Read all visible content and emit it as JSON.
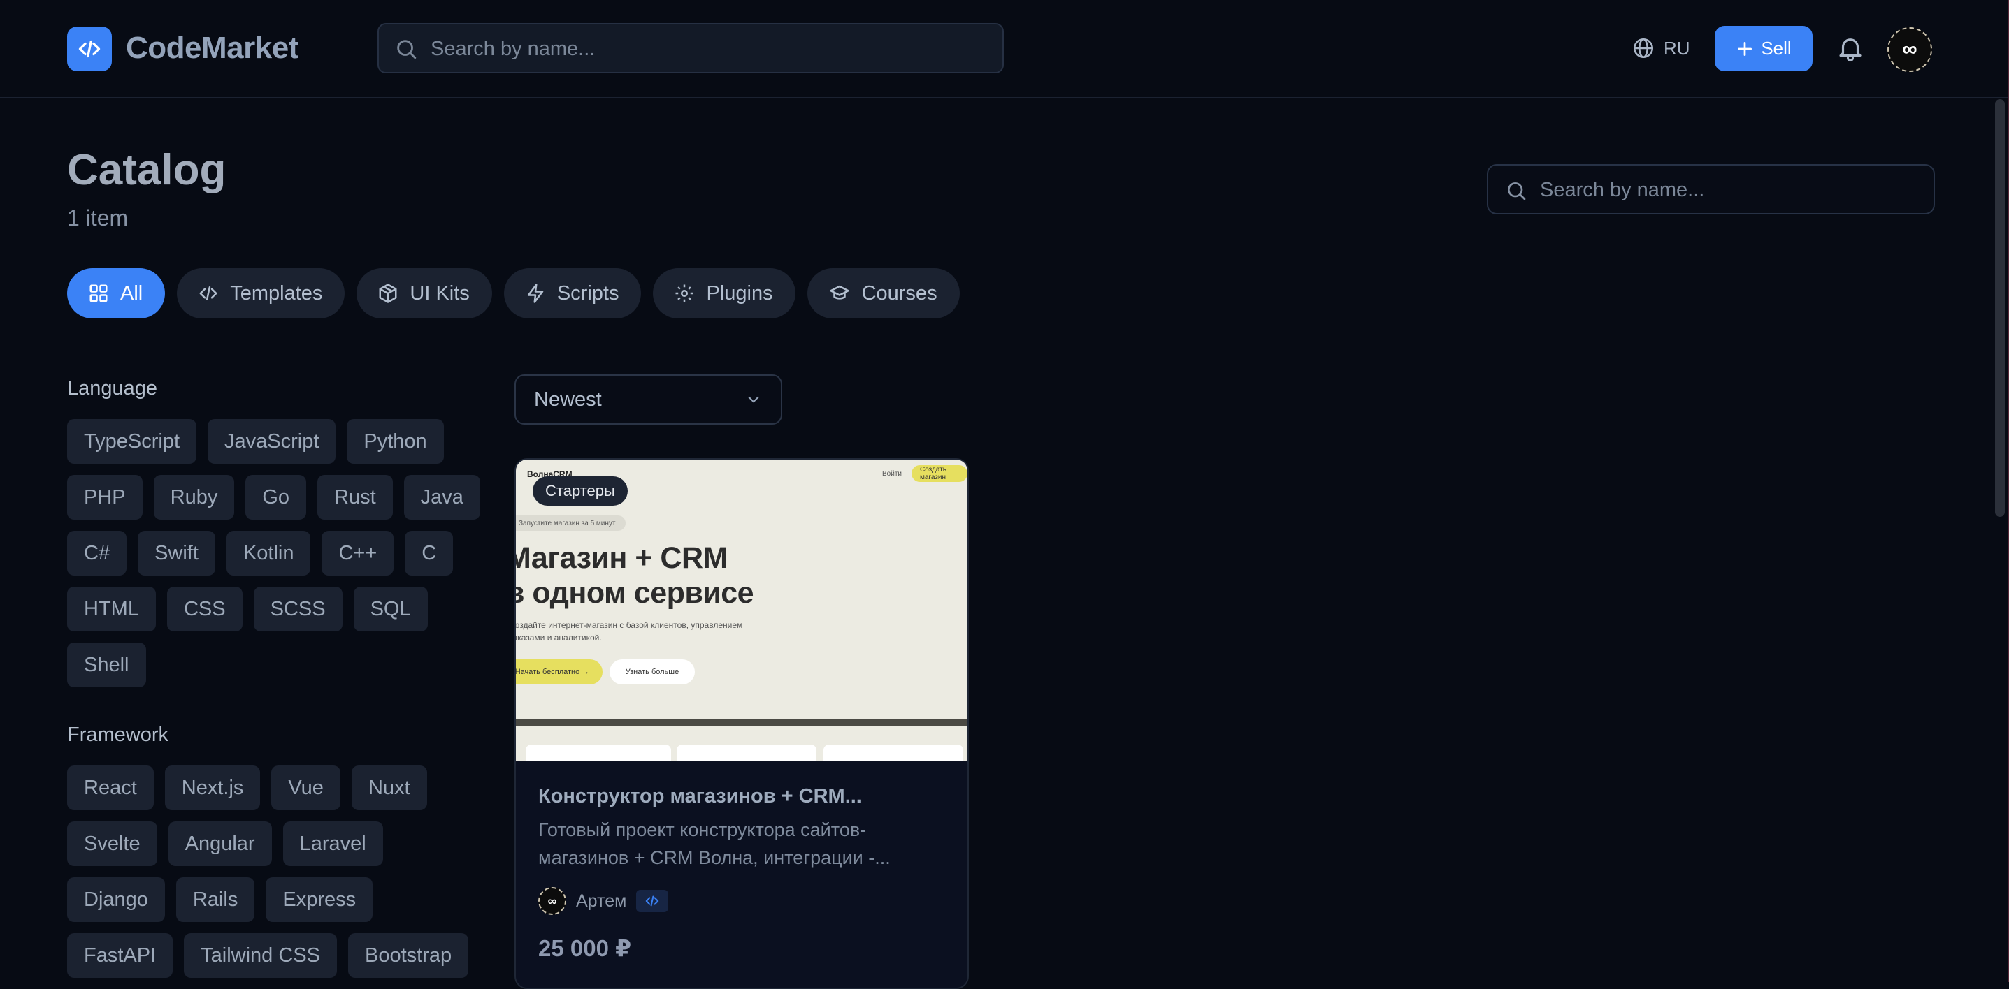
{
  "header": {
    "brand": "CodeMarket",
    "search_placeholder": "Search by name...",
    "language": "RU",
    "sell_label": "Sell",
    "avatar_glyph": "∞"
  },
  "catalog": {
    "title": "Catalog",
    "count": "1 item",
    "search_placeholder": "Search by name..."
  },
  "tabs": [
    {
      "label": "All",
      "icon": "grid-icon",
      "active": true
    },
    {
      "label": "Templates",
      "icon": "code-icon",
      "active": false
    },
    {
      "label": "UI Kits",
      "icon": "box-icon",
      "active": false
    },
    {
      "label": "Scripts",
      "icon": "lightning-icon",
      "active": false
    },
    {
      "label": "Plugins",
      "icon": "gear-icon",
      "active": false
    },
    {
      "label": "Courses",
      "icon": "graduation-cap-icon",
      "active": false
    }
  ],
  "filters": {
    "language": {
      "title": "Language",
      "options": [
        "TypeScript",
        "JavaScript",
        "Python",
        "PHP",
        "Ruby",
        "Go",
        "Rust",
        "Java",
        "C#",
        "Swift",
        "Kotlin",
        "C++",
        "C",
        "HTML",
        "CSS",
        "SCSS",
        "SQL",
        "Shell"
      ]
    },
    "framework": {
      "title": "Framework",
      "options": [
        "React",
        "Next.js",
        "Vue",
        "Nuxt",
        "Svelte",
        "Angular",
        "Laravel",
        "Django",
        "Rails",
        "Express",
        "FastAPI",
        "Tailwind CSS",
        "Bootstrap"
      ]
    }
  },
  "sort": {
    "selected": "Newest"
  },
  "product": {
    "badge": "Стартеры",
    "title": "Конструктор магазинов + CRM...",
    "description": "Готовый проект конструктора сайтов-магазинов + CRM Волна, интеграции -...",
    "author": "Артем",
    "author_avatar_glyph": "∞",
    "price": "25 000 ₽",
    "preview": {
      "brand": "ВолнаCRM",
      "login": "Войти",
      "create": "Создать магазин",
      "pill": "Запустите магазин за 5 минут",
      "headline_1": "Магазин + CRM",
      "headline_2": "в одном сервисе",
      "description": "Создайте интернет-магазин с базой клиентов, управлением заказами и аналитикой.",
      "cta_primary": "Начать бесплатно →",
      "cta_secondary": "Узнать больше"
    }
  },
  "colors": {
    "accent": "#3b82f6",
    "background": "#070b14",
    "chip": "#1b2230"
  }
}
